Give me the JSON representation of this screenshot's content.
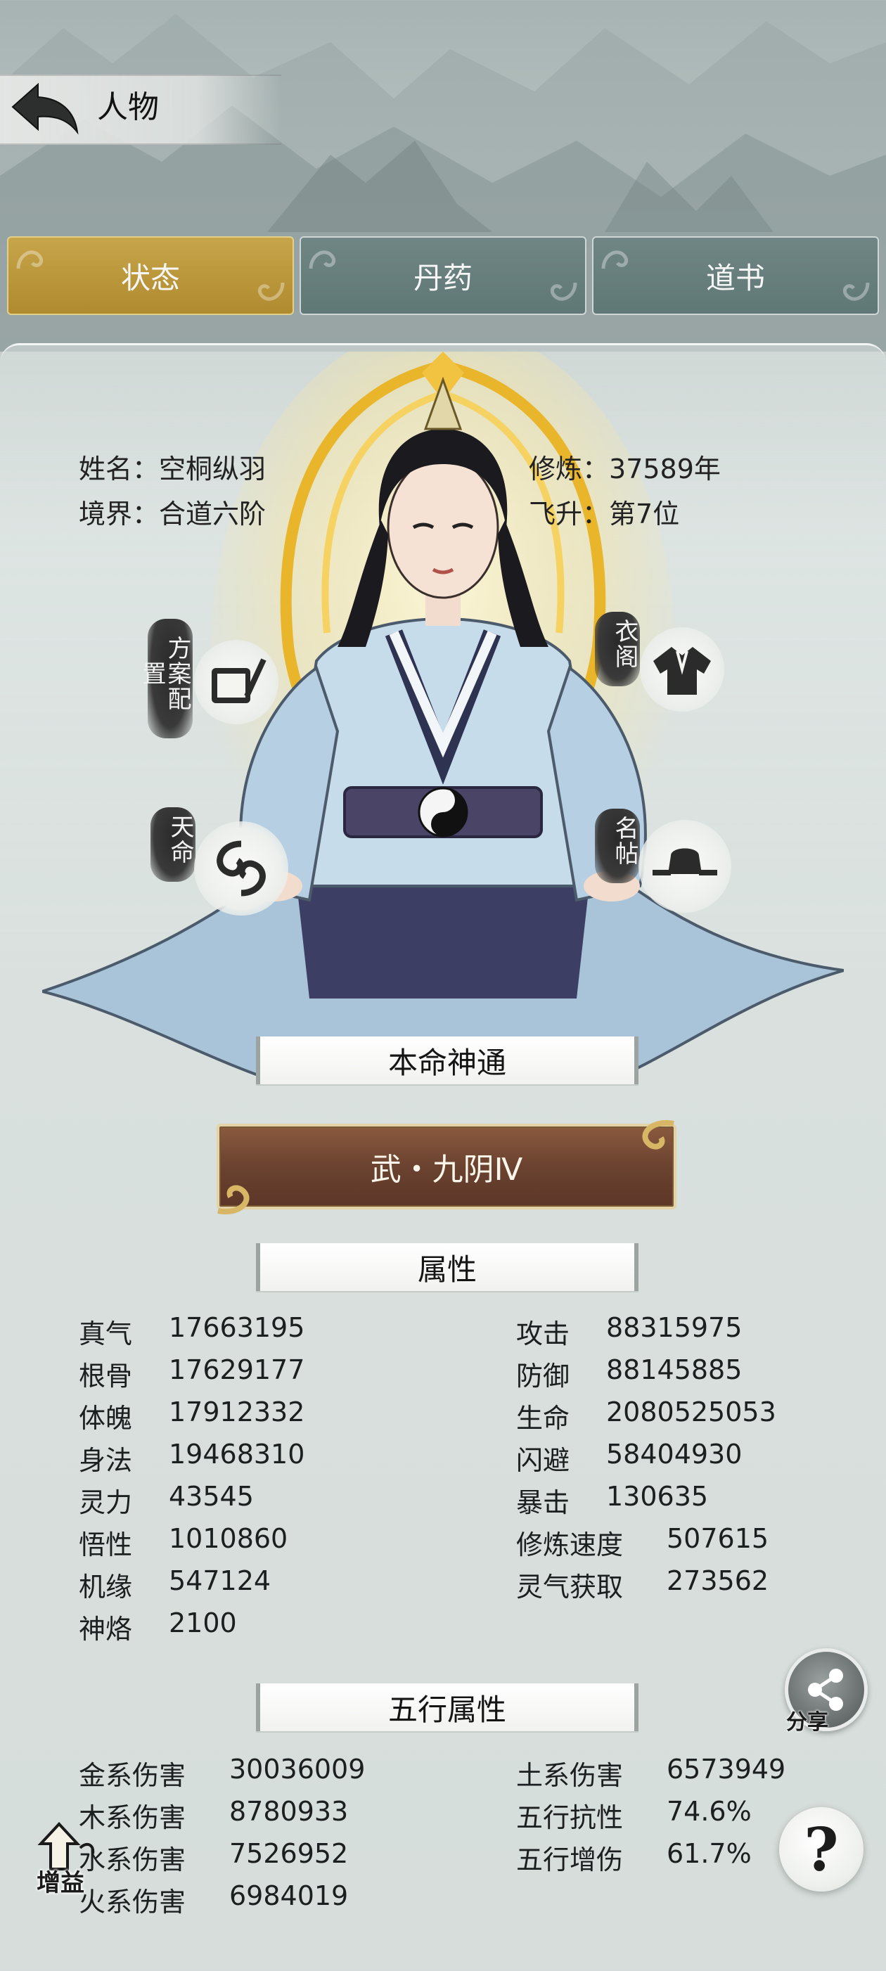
{
  "header": {
    "title": "人物"
  },
  "tabs": [
    {
      "label": "状态",
      "active": true
    },
    {
      "label": "丹药",
      "active": false
    },
    {
      "label": "道书",
      "active": false
    }
  ],
  "profile": {
    "name_label": "姓名：",
    "name": "空桐纵羽",
    "realm_label": "境界：",
    "realm": "合道六阶",
    "cultivation_label": "修炼：",
    "cultivation": "37589年",
    "ascension_label": "飞升：",
    "ascension": "第7位"
  },
  "side_buttons": {
    "plan": "方案配置",
    "wardrobe": "衣阁",
    "fate": "天命",
    "card": "名帖"
  },
  "skill": {
    "section_title": "本命神通",
    "name": "武・九阴Ⅳ"
  },
  "attributes": {
    "section_title": "属性",
    "left": [
      {
        "label": "真气",
        "value": "17663195"
      },
      {
        "label": "根骨",
        "value": "17629177"
      },
      {
        "label": "体魄",
        "value": "17912332"
      },
      {
        "label": "身法",
        "value": "19468310"
      },
      {
        "label": "灵力",
        "value": "43545"
      },
      {
        "label": "悟性",
        "value": "1010860"
      },
      {
        "label": "机缘",
        "value": "547124"
      },
      {
        "label": "神烙",
        "value": "2100"
      }
    ],
    "right": [
      {
        "label": "攻击",
        "value": "88315975"
      },
      {
        "label": "防御",
        "value": "88145885"
      },
      {
        "label": "生命",
        "value": "2080525053"
      },
      {
        "label": "闪避",
        "value": "58404930"
      },
      {
        "label": "暴击",
        "value": "130635"
      },
      {
        "label": "修炼速度",
        "value": "507615"
      },
      {
        "label": "灵气获取",
        "value": "273562"
      }
    ]
  },
  "elements": {
    "section_title": "五行属性",
    "left": [
      {
        "label": "金系伤害",
        "value": "30036009"
      },
      {
        "label": "木系伤害",
        "value": "8780933"
      },
      {
        "label": "水系伤害",
        "value": "7526952"
      },
      {
        "label": "火系伤害",
        "value": "6984019"
      }
    ],
    "right": [
      {
        "label": "土系伤害",
        "value": "6573949"
      },
      {
        "label": "五行抗性",
        "value": "74.6%"
      },
      {
        "label": "五行增伤",
        "value": "61.7%"
      }
    ]
  },
  "floating": {
    "share_label": "分享",
    "help_label": "?",
    "boost_label": "增益"
  },
  "colors": {
    "active_tab": "#b99433",
    "inactive_tab": "#667d7b",
    "skill_button": "#6b4230"
  }
}
